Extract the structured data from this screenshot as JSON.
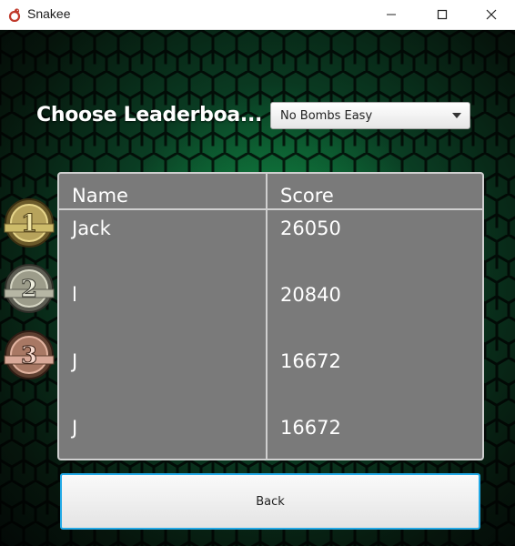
{
  "window": {
    "title": "Snakee"
  },
  "header": {
    "title": "Choose Leaderboa..."
  },
  "mode_select": {
    "value": "No Bombs Easy"
  },
  "leaderboard": {
    "columns": [
      "Name",
      "Score"
    ],
    "rows": [
      {
        "name": "Jack",
        "score": "26050"
      },
      {
        "name": "l",
        "score": "20840"
      },
      {
        "name": "J",
        "score": "16672"
      },
      {
        "name": "J",
        "score": "16672"
      }
    ],
    "medals": [
      "1",
      "2",
      "3"
    ]
  },
  "footer": {
    "back_label": "Back"
  },
  "colors": {
    "focus_border": "#22a9e6",
    "table_bg": "#7a7a7a",
    "background_glow": "#14be5a"
  }
}
